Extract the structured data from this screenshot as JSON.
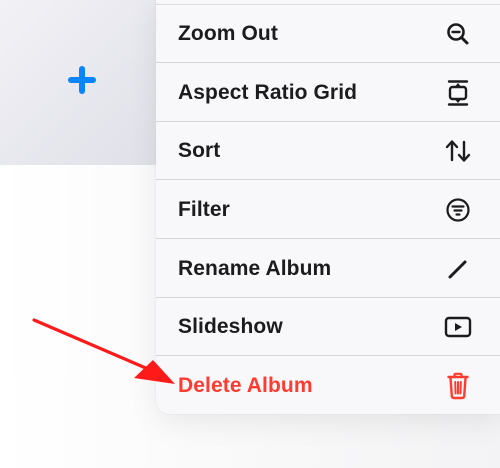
{
  "colors": {
    "accent_blue": "#0a84ff",
    "label": "#1c1c1e",
    "destructive": "#ff3b30",
    "separator": "#d6d6da",
    "annotation_arrow": "#ff1a1a"
  },
  "background": {
    "add_button_icon": "plus-icon"
  },
  "menu": {
    "items": [
      {
        "label": "Zoom Out",
        "icon": "zoom-out-icon",
        "destructive": false
      },
      {
        "label": "Aspect Ratio Grid",
        "icon": "aspect-ratio-icon",
        "destructive": false
      },
      {
        "label": "Sort",
        "icon": "sort-arrows-icon",
        "destructive": false
      },
      {
        "label": "Filter",
        "icon": "filter-icon",
        "destructive": false
      },
      {
        "label": "Rename Album",
        "icon": "pencil-icon",
        "destructive": false
      },
      {
        "label": "Slideshow",
        "icon": "play-rectangle-icon",
        "destructive": false
      },
      {
        "label": "Delete Album",
        "icon": "trash-icon",
        "destructive": true
      }
    ]
  },
  "annotation": {
    "type": "arrow",
    "points_to": "Delete Album"
  }
}
